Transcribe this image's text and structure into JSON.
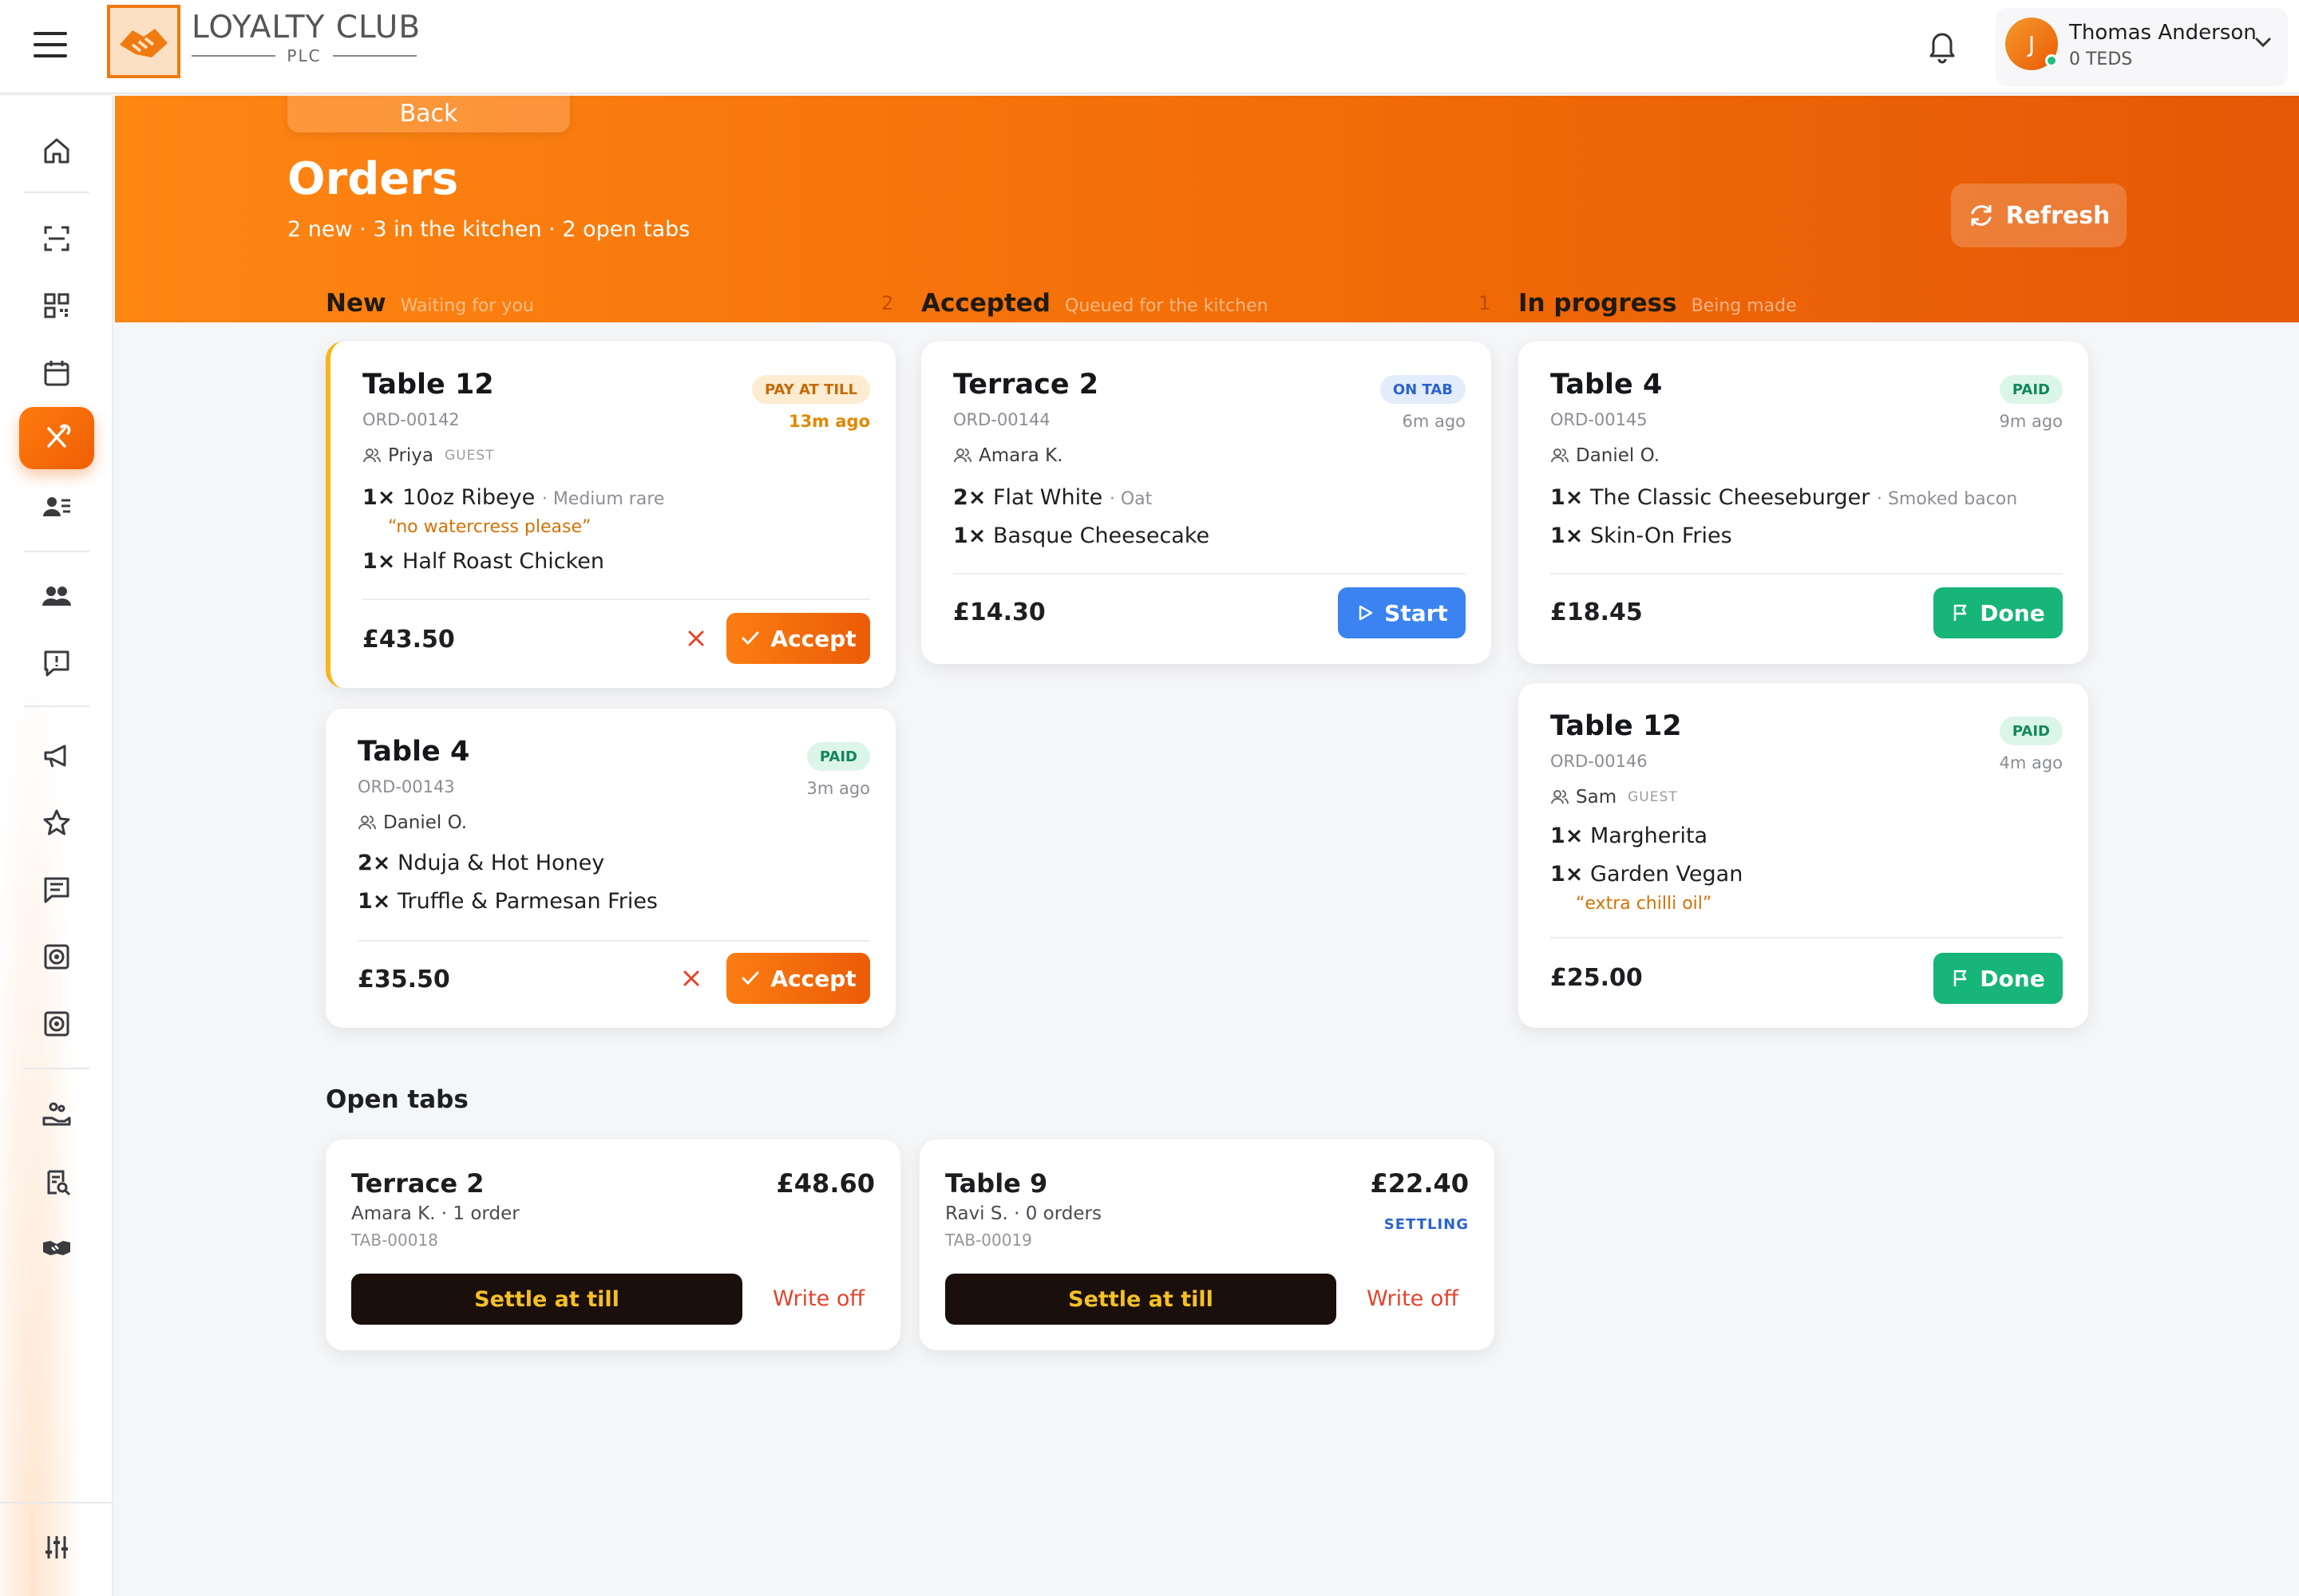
{
  "header": {
    "brand_title": "LOYALTY CLUB",
    "brand_sub": "PLC",
    "user_name": "Thomas Anderson",
    "user_sub": "0 TEDS",
    "avatar_initial": "J",
    "icons": [
      "menu-icon",
      "bell-icon",
      "chevron-down-icon"
    ]
  },
  "sidebar": {
    "items": [
      "home-icon",
      "scan-icon",
      "qr-code-icon",
      "calendar-icon",
      "orders-icon",
      "members-icon",
      "users-icon",
      "feedback-icon",
      "campaign-icon",
      "star-icon",
      "messages-icon",
      "target-icon",
      "target-alt-icon",
      "giving-icon",
      "audit-icon",
      "partnership-icon",
      "settings-icon"
    ],
    "active": "orders-icon"
  },
  "hero": {
    "back_label": "Back",
    "title": "Orders",
    "subtitle": "2 new · 3 in the kitchen · 2 open tabs",
    "refresh_label": "Refresh"
  },
  "columns": [
    {
      "title": "New",
      "subtitle": "Waiting for you",
      "count": "2"
    },
    {
      "title": "Accepted",
      "subtitle": "Queued for the kitchen",
      "count": "1"
    },
    {
      "title": "In progress",
      "subtitle": "Being made"
    }
  ],
  "orders": {
    "new": [
      {
        "table": "Table 12",
        "id": "ORD-00142",
        "badge": "PAY AT TILL",
        "time": "13m ago",
        "guest": "Priya",
        "guest_tag": "GUEST",
        "items": [
          {
            "qty": "1×",
            "name": "10oz Ribeye",
            "mod": "· Medium rare",
            "note": "“no watercress please”"
          },
          {
            "qty": "1×",
            "name": "Half Roast Chicken"
          }
        ],
        "total": "£43.50",
        "action": "Accept"
      },
      {
        "table": "Table 4",
        "id": "ORD-00143",
        "badge": "PAID",
        "time": "3m ago",
        "guest": "Daniel O.",
        "items": [
          {
            "qty": "2×",
            "name": "Nduja & Hot Honey"
          },
          {
            "qty": "1×",
            "name": "Truffle & Parmesan Fries"
          }
        ],
        "total": "£35.50",
        "action": "Accept"
      }
    ],
    "accepted": [
      {
        "table": "Terrace 2",
        "id": "ORD-00144",
        "badge": "ON TAB",
        "time": "6m ago",
        "guest": "Amara K.",
        "items": [
          {
            "qty": "2×",
            "name": "Flat White",
            "mod": "· Oat"
          },
          {
            "qty": "1×",
            "name": "Basque Cheesecake"
          }
        ],
        "total": "£14.30",
        "action": "Start"
      }
    ],
    "in_progress": [
      {
        "table": "Table 4",
        "id": "ORD-00145",
        "badge": "PAID",
        "time": "9m ago",
        "guest": "Daniel O.",
        "items": [
          {
            "qty": "1×",
            "name": "The Classic Cheeseburger",
            "mod": "· Smoked bacon"
          },
          {
            "qty": "1×",
            "name": "Skin-On Fries"
          }
        ],
        "total": "£18.45",
        "action": "Done"
      },
      {
        "table": "Table 12",
        "id": "ORD-00146",
        "badge": "PAID",
        "time": "4m ago",
        "guest": "Sam",
        "guest_tag": "GUEST",
        "items": [
          {
            "qty": "1×",
            "name": "Margherita"
          },
          {
            "qty": "1×",
            "name": "Garden Vegan",
            "note": "“extra chilli oil”"
          }
        ],
        "total": "£25.00",
        "action": "Done"
      }
    ]
  },
  "tabs": {
    "title": "Open tabs",
    "list": [
      {
        "name": "Terrace 2",
        "amount": "£48.60",
        "meta": "Amara K. · 1 order",
        "id": "TAB-00018",
        "settle": "Settle at till",
        "writeoff": "Write off"
      },
      {
        "name": "Table 9",
        "amount": "£22.40",
        "meta": "Ravi S. · 0 orders",
        "id": "TAB-00019",
        "status": "SETTLING",
        "settle": "Settle at till",
        "writeoff": "Write off"
      }
    ]
  },
  "colors": {
    "accent": "#f26c07",
    "paid": "#17b577",
    "tab": "#3a83f0",
    "warn": "#f7b51c"
  }
}
